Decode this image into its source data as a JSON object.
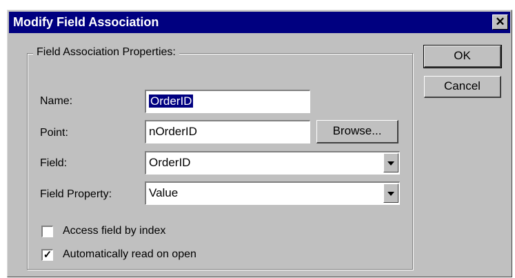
{
  "window": {
    "title": "Modify Field Association",
    "close_glyph": "✕"
  },
  "group": {
    "label": "Field Association Properties:"
  },
  "fields": {
    "name": {
      "label": "Name:",
      "value": "OrderID"
    },
    "point": {
      "label": "Point:",
      "value": "nOrderID"
    },
    "field": {
      "label": "Field:",
      "value": "OrderID"
    },
    "field_property": {
      "label": "Field Property:",
      "value": "Value"
    }
  },
  "buttons": {
    "ok": "OK",
    "cancel": "Cancel",
    "browse": "Browse..."
  },
  "checkboxes": {
    "access_by_index": {
      "label": "Access field by index",
      "checked": false,
      "mark": ""
    },
    "auto_read": {
      "label": "Automatically read on open",
      "checked": true,
      "mark": "✓"
    }
  },
  "colors": {
    "titlebar": "#000080",
    "face": "#c0c0c0"
  }
}
